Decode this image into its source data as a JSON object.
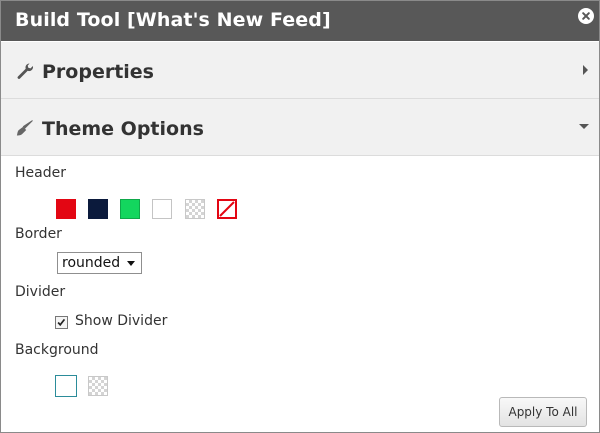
{
  "window": {
    "title": "Build Tool [What's New Feed]"
  },
  "sections": {
    "properties": {
      "label": "Properties",
      "icon": "wrench-icon",
      "state": "collapsed"
    },
    "theme_options": {
      "label": "Theme Options",
      "icon": "paintbrush-icon",
      "state": "expanded"
    }
  },
  "theme": {
    "header": {
      "label": "Header",
      "swatches": [
        {
          "name": "red",
          "color": "#e30613"
        },
        {
          "name": "navy",
          "color": "#0b1a3c"
        },
        {
          "name": "green",
          "color": "#13d65e"
        },
        {
          "name": "white",
          "color": "#ffffff"
        },
        {
          "name": "transparent",
          "color": "transparent"
        },
        {
          "name": "none",
          "color": "none"
        }
      ]
    },
    "border": {
      "label": "Border",
      "selected": "rounded"
    },
    "divider": {
      "label": "Divider",
      "checkbox_label": "Show Divider",
      "checked": true
    },
    "background": {
      "label": "Background",
      "swatches": [
        {
          "name": "white-selected",
          "color": "#ffffff",
          "selected": true
        },
        {
          "name": "transparent",
          "color": "transparent"
        }
      ]
    }
  },
  "buttons": {
    "apply_all": "Apply To All"
  }
}
